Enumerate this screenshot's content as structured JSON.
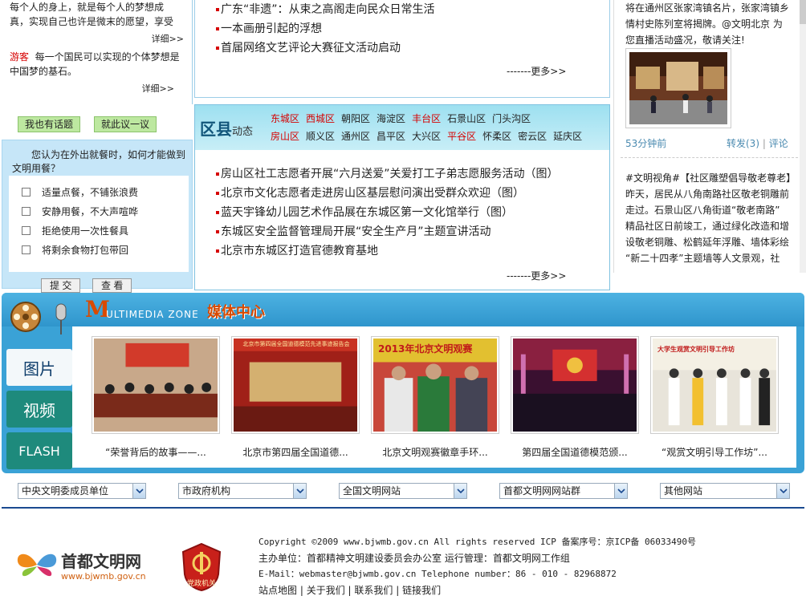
{
  "left_top": {
    "story1_lines": [
      "每个人的身上，就是每个人的梦想成",
      "真，实现自己也许是微末的愿望，享受"
    ],
    "detail1": "详细>>",
    "story2_user": "游客",
    "story2_lines": [
      "每一个国民可以实现的个体梦想是",
      "中国梦的基石。"
    ],
    "detail2": "详细>>",
    "btn_topic": "我也有话题",
    "btn_discuss": "就此议一议"
  },
  "poll": {
    "question": [
      "您认为在外出就餐时，如何才能做到",
      "文明用餐？"
    ],
    "options": [
      "适量点餐，不铺张浪费",
      "安静用餐，不大声喧哗",
      "拒绝使用一次性餐具",
      "将剩余食物打包带回"
    ],
    "submit": "提 交",
    "view": "查 看"
  },
  "mid_news": {
    "items": [
      "广东“非遗”：从束之高阁走向民众日常生活",
      "一本画册引起的浮想",
      "首届网络文艺评论大赛征文活动启动"
    ],
    "more": "-------更多>>"
  },
  "district": {
    "title": "区县",
    "title_small": "动态",
    "row1": [
      {
        "name": "东城区",
        "red": true
      },
      {
        "name": "西城区",
        "red": true
      },
      {
        "name": "朝阳区",
        "red": false
      },
      {
        "name": "海淀区",
        "red": false
      },
      {
        "name": "丰台区",
        "red": true
      },
      {
        "name": "石景山区",
        "red": false
      },
      {
        "name": "门头沟区",
        "red": false
      }
    ],
    "row2": [
      {
        "name": "房山区",
        "red": true
      },
      {
        "name": "顺义区",
        "red": false
      },
      {
        "name": "通州区",
        "red": false
      },
      {
        "name": "昌平区",
        "red": false
      },
      {
        "name": "大兴区",
        "red": false
      },
      {
        "name": "平谷区",
        "red": true
      },
      {
        "name": "怀柔区",
        "red": false
      },
      {
        "name": "密云区",
        "red": false
      },
      {
        "name": "延庆区",
        "red": false
      }
    ],
    "items": [
      "房山区社工志愿者开展“六月送爱”关爱打工子弟志愿服务活动（图）",
      "北京市文化志愿者走进房山区基层慰问演出受群众欢迎（图）",
      "蓝天宇锋幼儿园艺术作品展在东城区第一文化馆举行（图）",
      "东城区安全监督管理局开展“安全生产月”主题宣讲活动",
      "北京市东城区打造官德教育基地"
    ],
    "more": "-------更多>>"
  },
  "right": {
    "weibo1": [
      "将在通州区张家湾镇名片，张家湾镇乡",
      "情村史陈列室将揭牌。@文明北京 为",
      "您直播活动盛况，敬请关注!"
    ],
    "time": "53分钟前",
    "repost": "转发(3)",
    "comment": "评论",
    "weibo2": [
      "#文明视角#【社区雕塑倡导敬老尊老】",
      "昨天，居民从八角南路社区敬老铜雕前",
      "走过。石景山区八角街道“敬老南路”",
      "精品社区日前竣工，通过绿化改造和增",
      "设敬老铜雕、松鹤延年浮雕、墙体彩绘",
      "“新二十四孝”主题墙等人文景观，社"
    ]
  },
  "media": {
    "letter": "M",
    "zone_en": "ULTIMEDIA ZONE",
    "zone_cn": "媒体中心",
    "tabs": [
      "图片",
      "视频",
      "FLASH"
    ],
    "photos": [
      {
        "caption": "“荣誉背后的故事——...",
        "banner": ""
      },
      {
        "caption": "北京市第四届全国道德...",
        "banner": "北京市第四届全国道德模范先进事迹报告会"
      },
      {
        "caption": "北京文明观赛徽章手环...",
        "banner": "2013年北京文明观赛"
      },
      {
        "caption": "第四届全国道德模范颁...",
        "banner": ""
      },
      {
        "caption": "“观赏文明引导工作坊”...",
        "banner": "大学生观赏文明引导工作坊"
      }
    ]
  },
  "links_bar": {
    "selects": [
      "中央文明委成员单位",
      "市政府机构",
      "全国文明网站",
      "首都文明网网站群",
      "其他网站"
    ]
  },
  "footer": {
    "logo_cn": "首都文明网",
    "logo_url": "www.bjwmb.gov.cn",
    "badge": "党政机关",
    "copyright": "Copyright ©2009 www.bjwmb.gov.cn  All rights reserved ICP 备案序号：京ICP备 06033490号",
    "sponsor": "主办单位：首都精神文明建设委员会办公室  运行管理：首都文明网工作组",
    "email": "E-Mail：webmaster@bjwmb.gov.cn Telephone number：86 - 010 - 82968872",
    "links": [
      "站点地图",
      "关于我们",
      "联系我们",
      "链接我们"
    ]
  }
}
